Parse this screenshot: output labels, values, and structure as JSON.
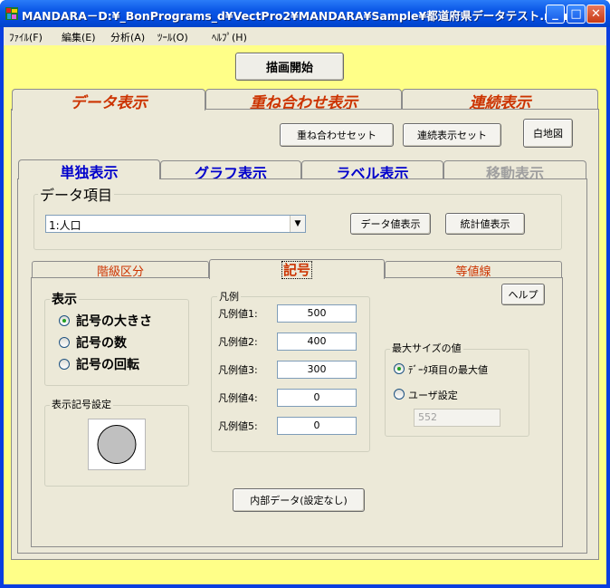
{
  "window": {
    "title": "MANDARA－D:¥_BonPrograms_d¥VectPro2¥MANDARA¥Sample¥都道府県データテスト.mdr",
    "minimize_glyph": "_",
    "maximize_glyph": "□",
    "close_glyph": "✕"
  },
  "menu": {
    "items": [
      "ﾌｧｲﾙ(F)",
      "編集(E)",
      "分析(A)",
      "ﾂｰﾙ(O)",
      "ﾍﾙﾌﾟ(H)"
    ]
  },
  "toolbar": {
    "start_drawing": "描画開始"
  },
  "main_tabs": [
    "データ表示",
    "重ね合わせ表示",
    "連続表示"
  ],
  "main_tab_selected": "データ表示",
  "top_buttons": {
    "overlay_set": "重ね合わせセット",
    "sequence_set": "連続表示セット",
    "blank_map": "白地図"
  },
  "sub_tabs": [
    "単独表示",
    "グラフ表示",
    "ラベル表示",
    "移動表示"
  ],
  "sub_tab_selected": "単独表示",
  "data_item": {
    "group_label": "データ項目",
    "selected": "1:人口",
    "show_values_button": "データ値表示",
    "show_stats_button": "統計値表示"
  },
  "mode_tabs": [
    "階級区分",
    "記号",
    "等値線"
  ],
  "mode_tab_selected": "記号",
  "help_button": "ヘルプ",
  "display": {
    "group_label": "表示",
    "options": [
      "記号の大きさ",
      "記号の数",
      "記号の回転"
    ],
    "selected_index": 0
  },
  "symbol_setting": {
    "group_label": "表示記号設定",
    "symbol": "circle-symbol-icon"
  },
  "legend": {
    "group_label": "凡例",
    "rows": [
      {
        "label": "凡例値1:",
        "value": "500"
      },
      {
        "label": "凡例値2:",
        "value": "400"
      },
      {
        "label": "凡例値3:",
        "value": "300"
      },
      {
        "label": "凡例値4:",
        "value": "0"
      },
      {
        "label": "凡例値5:",
        "value": "0"
      }
    ]
  },
  "max_size": {
    "group_label": "最大サイズの値",
    "options": [
      "ﾃﾞｰﾀ項目の最大値",
      "ユーザ設定"
    ],
    "selected_index": 0,
    "user_value": "552"
  },
  "internal_data_button": "内部データ(設定なし)",
  "colors": {
    "accent_tab_text": "#cc3300",
    "sub_tab_text": "#0000cc",
    "disabled_text": "#a0a0a0",
    "client_bg": "#ffff88",
    "panel_bg": "#ece9d8"
  }
}
